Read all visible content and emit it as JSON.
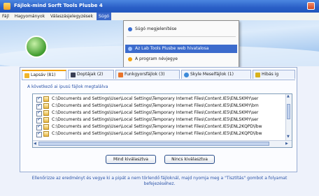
{
  "window": {
    "title": "Fájlok-mind Sorft Tools Plusbe 4",
    "colors": {
      "titlebar": "#2a5fc7",
      "accent": "#f2a30c",
      "link_text": "#2d55a8"
    }
  },
  "menu": {
    "items": [
      "Fájl",
      "Hagyományok",
      "Válaszásjelegyzések",
      "Súgó"
    ],
    "active_index": 3
  },
  "dropdown": {
    "items": [
      {
        "label": "Súgó megjelenítése",
        "icon": "help-icon"
      },
      {
        "label": "Az Lab Tools Plusbe web hivatalosa",
        "icon": "web-icon"
      },
      {
        "label": "A program névjegye",
        "icon": "info-icon"
      }
    ],
    "highlighted_index": 1
  },
  "tabs": [
    {
      "label": "Lapsáv (81)",
      "icon": "folder-icon"
    },
    {
      "label": "Doptájak (2)",
      "icon": "monitor-icon"
    },
    {
      "label": "Funkgyorsfájlok (3)",
      "icon": "wand-icon"
    },
    {
      "label": "Skyle Meselfájlok (1)",
      "icon": "globe-icon"
    },
    {
      "label": "Hibás ig",
      "icon": "warning-icon"
    }
  ],
  "section_label": "A következő ai ipusú fájlok megtalálva",
  "files": [
    {
      "path": "C:\\Documents and Settings\\User\\Local Settings\\Temporary Internet Files\\Content.IE5\\ENLSKMY\\ser",
      "checked": true
    },
    {
      "path": "C:\\Documents and Settings\\User\\Local Settings\\Temporary Internet Files\\Content.IE5\\ENLSKMY\\bm",
      "checked": true
    },
    {
      "path": "C:\\Documents and Settings\\User\\Local Settings\\Temporary Internet Files\\Content.IE5\\ENLSKMY\\ser",
      "checked": true
    },
    {
      "path": "C:\\Documents and Settings\\User\\Local Settings\\Temporary Internet Files\\Content.IE5\\ENLSKMY\\ser",
      "checked": true
    },
    {
      "path": "C:\\Documents and Settings\\User\\Local Settings\\Temporary Internet Files\\Content.IE5\\ENL2KQPD\\lbw",
      "checked": true
    },
    {
      "path": "C:\\Documents and Settings\\User\\Local Settings\\Temporary Internet Files\\Content.IE5\\ENL2KQPD\\lbw",
      "checked": true
    }
  ],
  "buttons": {
    "select_all": "Mind kiválasztva",
    "deselect_all": "Nincs kiválasztva"
  },
  "footer_note": "Ellenőrizze az eredményt és vegye ki a pipát a nem törlendő fájloknál, majd nyomja meg a \"Tisztítás\" gombot a folyamat befejezéséhez."
}
